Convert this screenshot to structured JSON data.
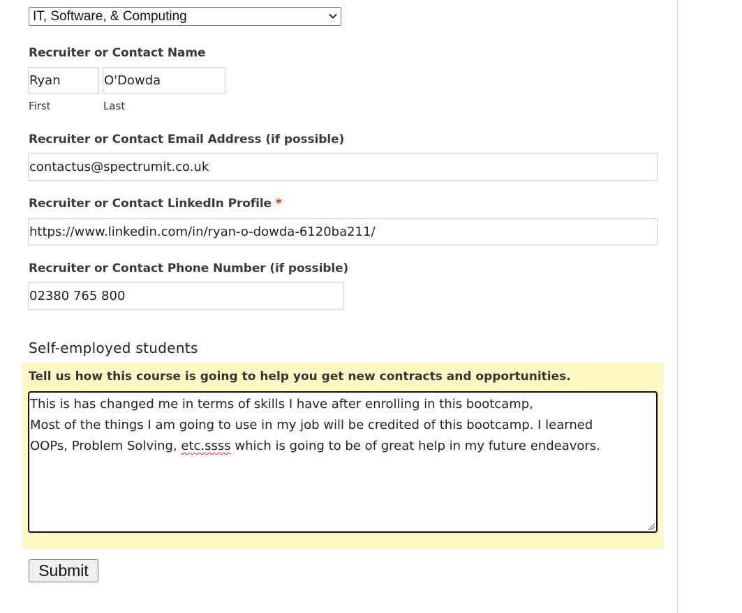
{
  "industry_select": {
    "selected": "IT, Software, & Computing",
    "icon": "chevron-down-icon"
  },
  "contact_name": {
    "label": "Recruiter or Contact Name",
    "first_value": "Ryan",
    "last_value": "O'Dowda",
    "first_sublabel": "First",
    "last_sublabel": "Last"
  },
  "contact_email": {
    "label": "Recruiter or Contact Email Address (if possible)",
    "value": "contactus@spectrumit.co.uk"
  },
  "contact_linkedin": {
    "label": "Recruiter or Contact LinkedIn Profile",
    "required_marker": "*",
    "value": "https://www.linkedin.com/in/ryan-o-dowda-6120ba211/"
  },
  "contact_phone": {
    "label": "Recruiter or Contact Phone Number (if possible)",
    "value": "02380 765 800"
  },
  "self_employed": {
    "heading": "Self-employed students",
    "question": "Tell us how this course is going to help you get new contracts and opportunities.",
    "answer_line1": "This is has changed me in terms of skills I have after enrolling in this bootcamp,",
    "answer_line2": "Most of the things I am going to use in my job will be credited of this bootcamp. I learned",
    "answer_line3_before": "OOPs, Problem Solving, ",
    "answer_line3_misspelled": "etc.ssss",
    "answer_line3_after": " which is going to be of great help in my future endeavors.",
    "highlight_color": "#fff7c2"
  },
  "submit": {
    "label": "Submit"
  },
  "colors": {
    "required": "#e0201a",
    "spellcheck": "#e02020"
  }
}
